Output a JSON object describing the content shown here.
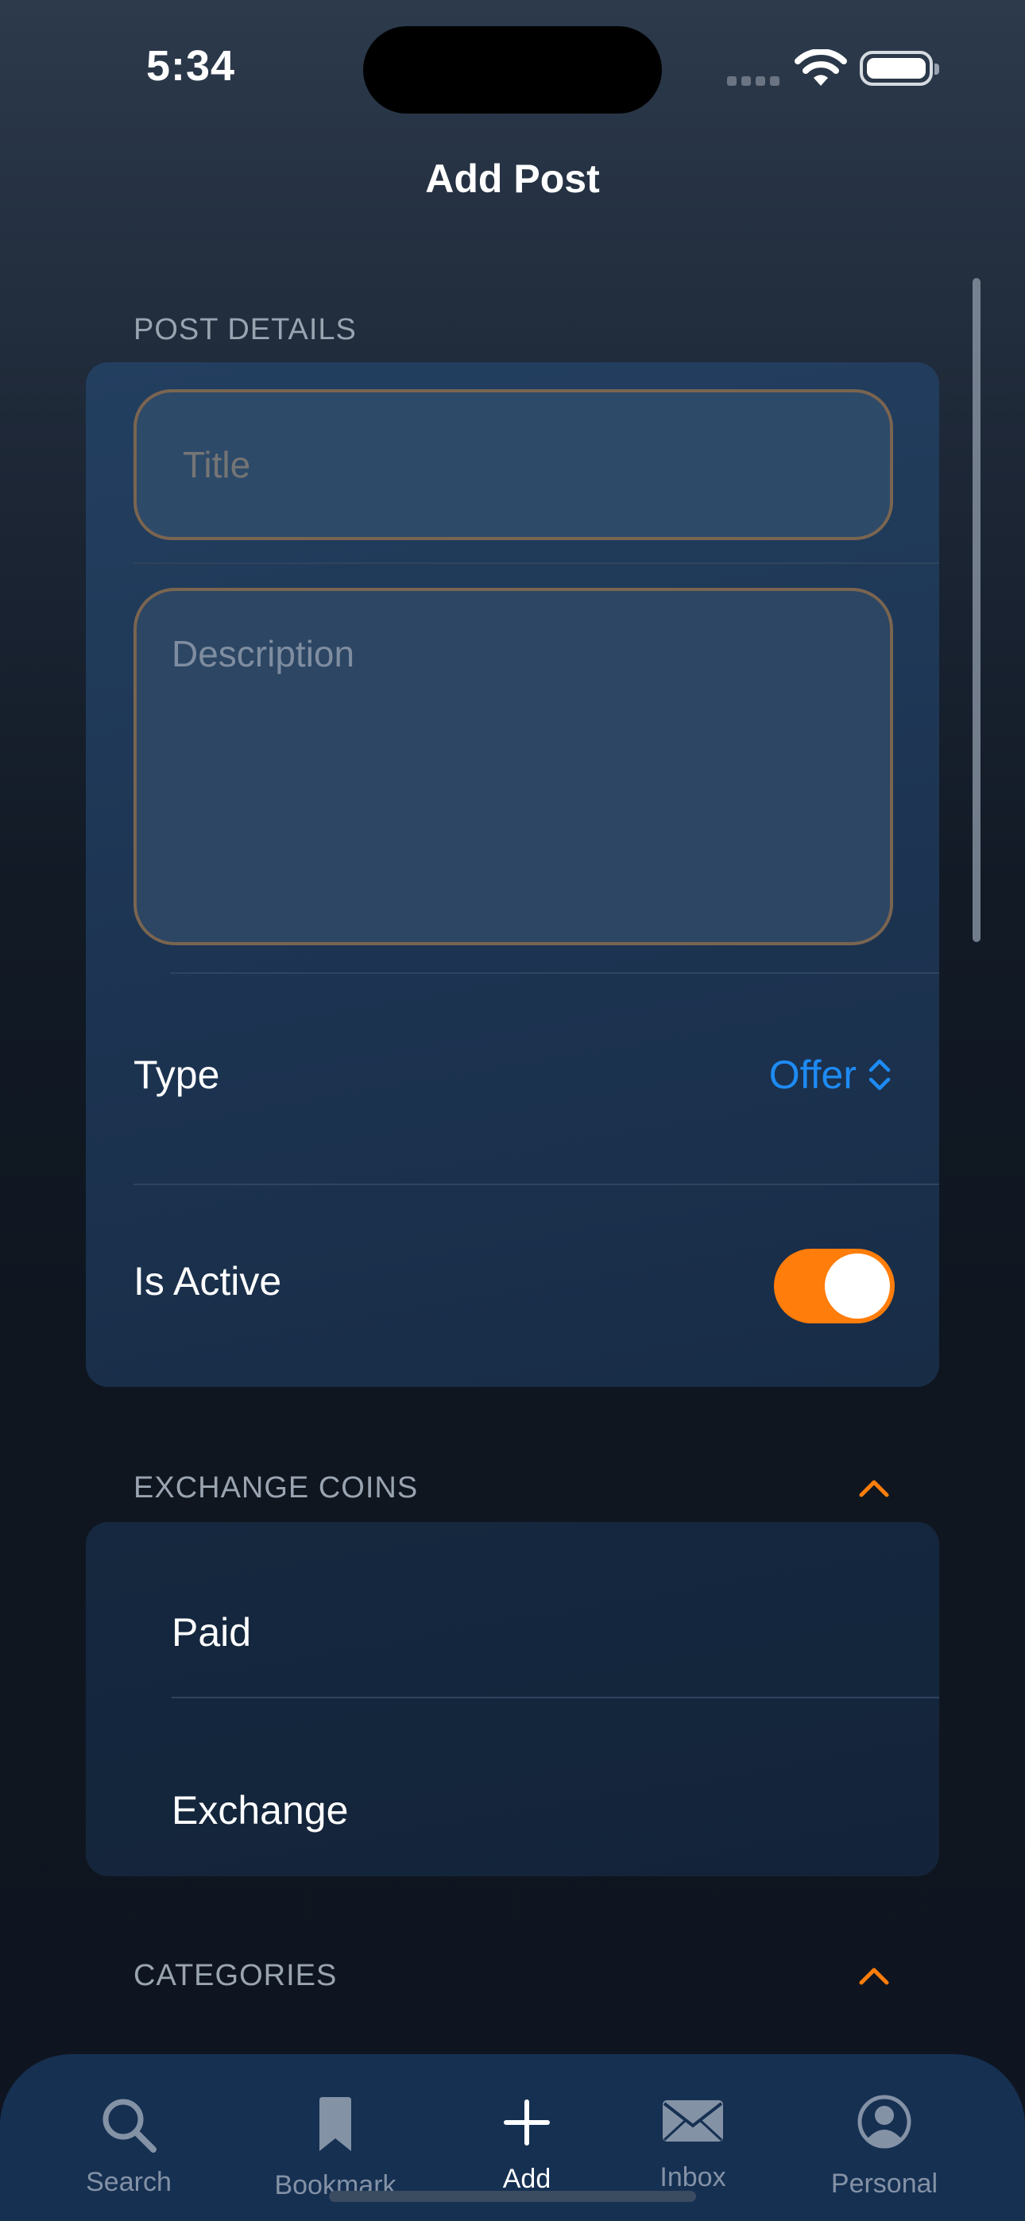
{
  "status_bar": {
    "time": "5:34",
    "icons": [
      "signal-icon",
      "wifi-icon",
      "battery-icon"
    ]
  },
  "nav": {
    "title": "Add Post"
  },
  "post_details": {
    "header": "POST DETAILS",
    "title_placeholder": "Title",
    "description_placeholder": "Description",
    "type_label": "Type",
    "type_value": "Offer",
    "active_label": "Is Active",
    "active": true
  },
  "exchange_coins": {
    "header": "EXCHANGE COINS",
    "items": [
      "Paid",
      "Exchange"
    ]
  },
  "categories": {
    "header": "CATEGORIES"
  },
  "tab_bar": {
    "tabs": [
      {
        "label": "Search",
        "icon": "search-icon",
        "active": false
      },
      {
        "label": "Bookmark",
        "icon": "bookmark-icon",
        "active": false
      },
      {
        "label": "Add",
        "icon": "plus-icon",
        "active": true
      },
      {
        "label": "Inbox",
        "icon": "envelope-icon",
        "active": false
      },
      {
        "label": "Personal",
        "icon": "person-circle-icon",
        "active": false
      }
    ]
  },
  "colors": {
    "accent_orange": "#ff7d0b",
    "link_blue": "#1e8bf4",
    "tab_bar": "#163052"
  }
}
